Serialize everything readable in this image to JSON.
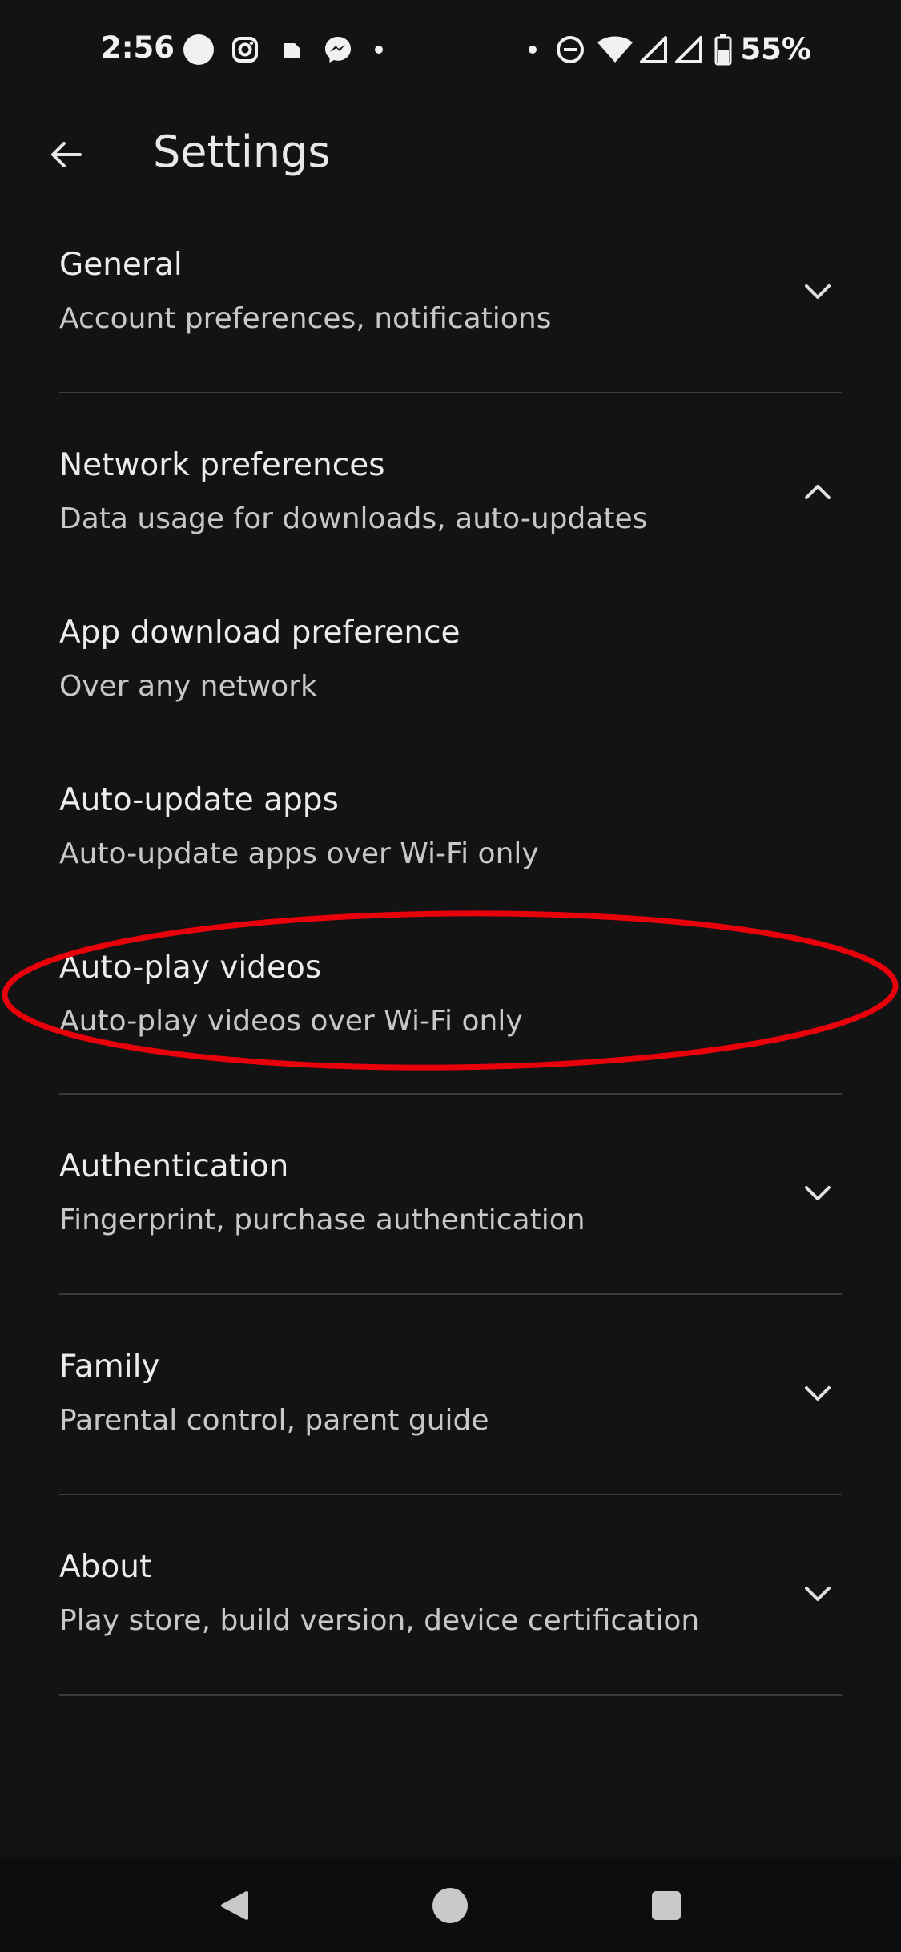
{
  "status_bar": {
    "time": "2:56",
    "battery": "55%",
    "icons": [
      "circle-notification-icon",
      "instagram-icon",
      "square-notification-icon",
      "messenger-icon",
      "dot-icon",
      "dot-icon",
      "do-not-disturb-icon",
      "wifi-icon",
      "signal-icon",
      "signal-icon",
      "battery-icon"
    ]
  },
  "app_bar": {
    "title": "Settings",
    "back_icon": "arrow-back-icon"
  },
  "settings": [
    {
      "title": "General",
      "subtitle": "Account preferences, notifications",
      "state": "collapsed"
    },
    {
      "title": "Network preferences",
      "subtitle": "Data usage for downloads, auto-updates",
      "state": "expanded"
    },
    {
      "title": "App download preference",
      "subtitle": "Over any network"
    },
    {
      "title": "Auto-update apps",
      "subtitle": "Auto-update apps over Wi-Fi only"
    },
    {
      "title": "Auto-play videos",
      "subtitle": "Auto-play videos over Wi-Fi only"
    },
    {
      "title": "Authentication",
      "subtitle": "Fingerprint, purchase authentication",
      "state": "collapsed"
    },
    {
      "title": "Family",
      "subtitle": "Parental control, parent guide",
      "state": "collapsed"
    },
    {
      "title": "About",
      "subtitle": "Play store, build version, device certification",
      "state": "collapsed"
    }
  ],
  "annotation": {
    "color": "#e8000b"
  },
  "nav_bar": {
    "icons": [
      "back-triangle-icon",
      "home-circle-icon",
      "recents-square-icon"
    ]
  }
}
